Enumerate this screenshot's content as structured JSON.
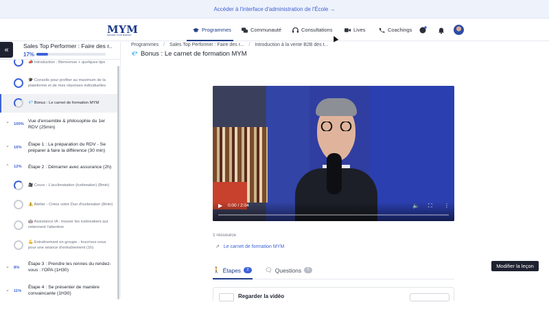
{
  "banner": {
    "text": "Accéder à l'interface d'administration de l'École →"
  },
  "brand": {
    "logo": "MYM",
    "tagline": "MASTER YOUR MARKET"
  },
  "nav": {
    "items": [
      {
        "label": "Programmes",
        "icon": "graduation-cap-icon",
        "active": true
      },
      {
        "label": "Communauté",
        "icon": "chat-bubbles-icon"
      },
      {
        "label": "Consultations",
        "icon": "headset-icon"
      },
      {
        "label": "Lives",
        "icon": "video-camera-icon"
      },
      {
        "label": "Coachings",
        "icon": "phone-icon"
      }
    ]
  },
  "sidebar": {
    "course_title": "Sales Top Performer : Faire des r...",
    "progress_label": "17%",
    "progress_value": 0.17,
    "lessons_top": [
      {
        "text": "📣 Introduction : Bienvenue + quelques tips",
        "state": "done"
      },
      {
        "text": "🎓 Conseils pour profiter au maximum de la plateforme et de mes réponses individuelles",
        "state": "done"
      },
      {
        "text": "💎 Bonus : Le carnet de formation MYM",
        "state": "half",
        "active": true
      }
    ],
    "sections": [
      {
        "chevron": "⌄",
        "pct": "100%",
        "title": "Vue d'ensemble & philosophie du 1er RDV (25min)"
      },
      {
        "chevron": "⌄",
        "pct": "16%",
        "title": "Étape 1 : La préparation du RDV - Se préparer à faire la différence (30 min)"
      },
      {
        "chevron": "⌃",
        "pct": "12%",
        "title": "Étape 2 : Démarrer avec assurance (2h)"
      }
    ],
    "lessons_step2": [
      {
        "text": "🎥 Cours - L'acclimatation (icebreaker) (8min)",
        "state": "half"
      },
      {
        "text": "⚠️ Atelier - Créez votre Duo d'icebreaker (8min)",
        "state": "empty"
      },
      {
        "text": "🤖 Assistance IA : trouver les icebreakers qui retiennent l'attention",
        "state": "empty"
      },
      {
        "text": "💪 Entraînement en groupe - Inscrivez-vous pour une séance d'entraînement (1h)",
        "state": "empty"
      }
    ],
    "sections_after": [
      {
        "chevron": "⌄",
        "pct": "8%",
        "title": "Étape 3 : Prendre les rennes du rendez-vous : l'OPA (1H30)"
      },
      {
        "chevron": "⌄",
        "pct": "11%",
        "title": "Étape 4 : Se présenter de manière convaincante (1H30)"
      }
    ]
  },
  "breadcrumb": {
    "items": [
      "Programmes",
      "Sales Top Performer : Faire des r...",
      "Introduction à la vente B2B des t..."
    ],
    "separator": "/"
  },
  "page": {
    "title_icon": "💎",
    "title": "Bonus : Le carnet de formation MYM"
  },
  "video": {
    "time": "0:00 / 2:04",
    "progress": 0
  },
  "resources": {
    "count_label": "1 ressource",
    "link": "Le carnet de formation MYM"
  },
  "tabs": [
    {
      "label": "Étapes",
      "count": "2",
      "active": true,
      "count_color": "#3d62d8"
    },
    {
      "label": "Questions",
      "count": "0",
      "count_color": "#b8bcc6"
    }
  ],
  "step_card": {
    "title": "Regarder la vidéo"
  },
  "edit_button": {
    "label": "Modifier la leçon"
  }
}
